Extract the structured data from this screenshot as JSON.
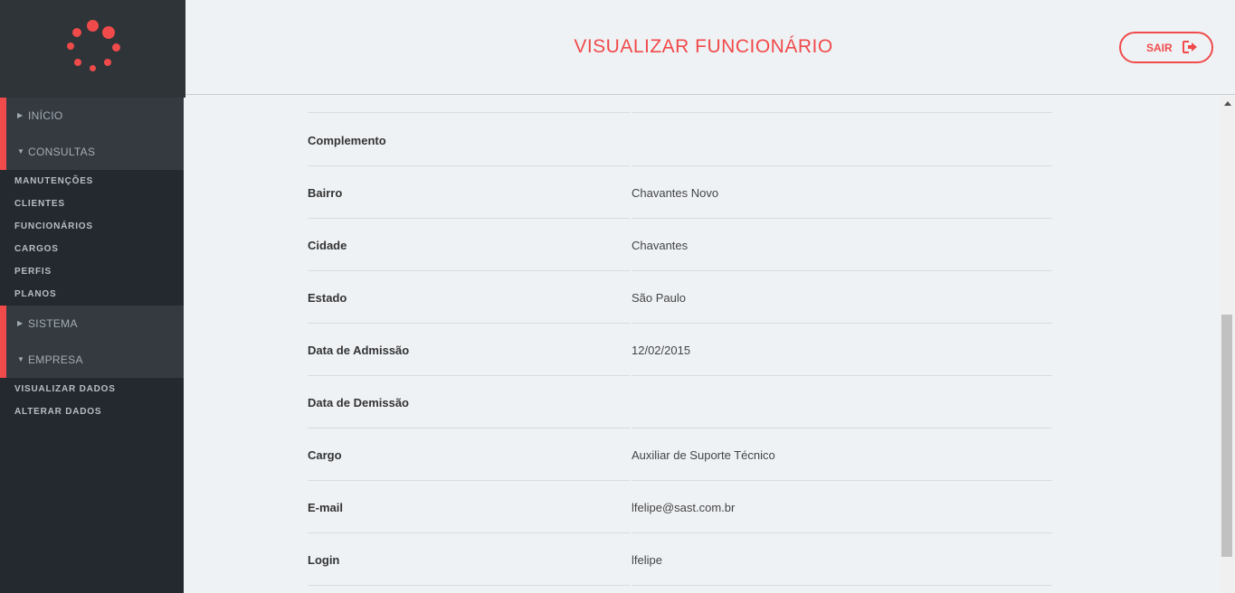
{
  "header": {
    "title": "VISUALIZAR FUNCIONÁRIO",
    "logout_label": "SAIR"
  },
  "sidebar": {
    "groups": [
      {
        "label": "INÍCIO",
        "expanded": false,
        "items": []
      },
      {
        "label": "CONSULTAS",
        "expanded": true,
        "items": [
          "MANUTENÇÕES",
          "CLIENTES",
          "FUNCIONÁRIOS",
          "CARGOS",
          "PERFIS",
          "PLANOS"
        ]
      },
      {
        "label": "SISTEMA",
        "expanded": false,
        "items": []
      },
      {
        "label": "EMPRESA",
        "expanded": true,
        "items": [
          "VISUALIZAR DADOS",
          "ALTERAR DADOS"
        ]
      }
    ]
  },
  "details": [
    {
      "label": "Complemento",
      "value": ""
    },
    {
      "label": "Bairro",
      "value": "Chavantes Novo"
    },
    {
      "label": "Cidade",
      "value": "Chavantes"
    },
    {
      "label": "Estado",
      "value": "São Paulo"
    },
    {
      "label": "Data de Admissão",
      "value": "12/02/2015"
    },
    {
      "label": "Data de Demissão",
      "value": ""
    },
    {
      "label": "Cargo",
      "value": "Auxiliar de Suporte Técnico"
    },
    {
      "label": "E-mail",
      "value": "lfelipe@sast.com.br"
    },
    {
      "label": "Login",
      "value": "lfelipe"
    }
  ],
  "icons": {
    "logo": "spinner-dots-logo",
    "logout": "sign-out-icon",
    "caret_right": "caret-right-icon",
    "caret_down": "caret-down-icon"
  },
  "colors": {
    "accent": "#f04a4a",
    "sidebar_bg": "#23292e",
    "sidebar_header_bg": "#343a40",
    "content_bg": "#eff2f5"
  }
}
